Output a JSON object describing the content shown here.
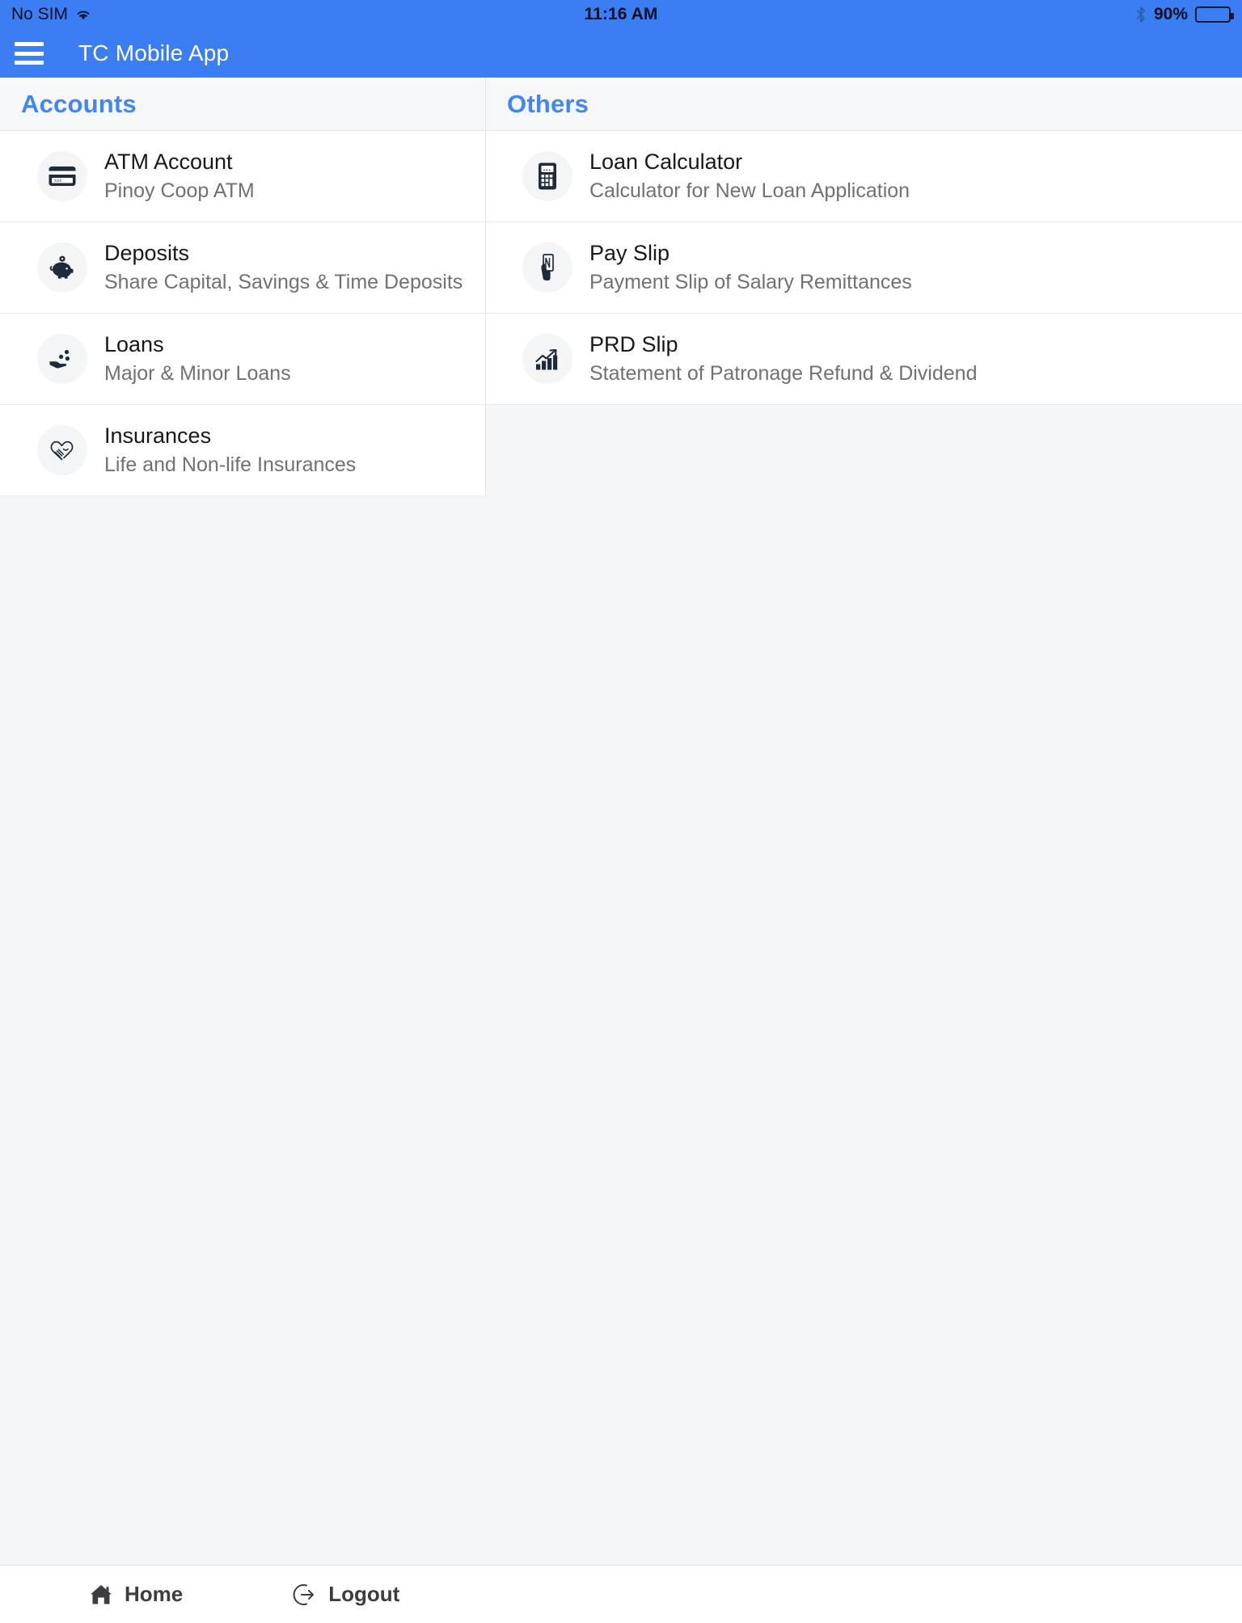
{
  "status_bar": {
    "carrier": "No SIM",
    "wifi_icon": "wifi-icon",
    "time": "11:16 AM",
    "bluetooth_icon": "bluetooth-icon",
    "battery_percent": "90%",
    "battery_icon": "battery-icon",
    "battery_level": 90
  },
  "app_bar": {
    "menu_icon": "hamburger-menu-icon",
    "title": "TC Mobile App",
    "background_color": "#3b7df2"
  },
  "sections": {
    "accounts": {
      "header": "Accounts",
      "items": [
        {
          "title": "ATM Account",
          "subtitle": "Pinoy Coop ATM",
          "icon": "credit-card-icon"
        },
        {
          "title": "Deposits",
          "subtitle": "Share Capital, Savings & Time Deposits",
          "icon": "piggy-bank-icon"
        },
        {
          "title": "Loans",
          "subtitle": "Major & Minor Loans",
          "icon": "hand-coins-icon"
        },
        {
          "title": "Insurances",
          "subtitle": "Life and Non-life Insurances",
          "icon": "hand-heart-icon"
        }
      ]
    },
    "others": {
      "header": "Others",
      "items": [
        {
          "title": "Loan Calculator",
          "subtitle": "Calculator for New Loan Application",
          "icon": "calculator-icon"
        },
        {
          "title": "Pay Slip",
          "subtitle": "Payment Slip of Salary Remittances",
          "icon": "hand-document-icon"
        },
        {
          "title": "PRD Slip",
          "subtitle": "Statement of Patronage Refund & Dividend",
          "icon": "bar-chart-growth-icon"
        }
      ]
    }
  },
  "bottom_nav": {
    "home_label": "Home",
    "home_icon": "home-icon",
    "logout_label": "Logout",
    "logout_icon": "logout-icon"
  },
  "colors": {
    "accent_blue": "#4285f4",
    "appbar_blue": "#3b7df2",
    "icon_dark": "#1e2b3a",
    "page_background": "#f5f6f7",
    "text_primary": "#16181c",
    "text_secondary": "#6f7175"
  }
}
